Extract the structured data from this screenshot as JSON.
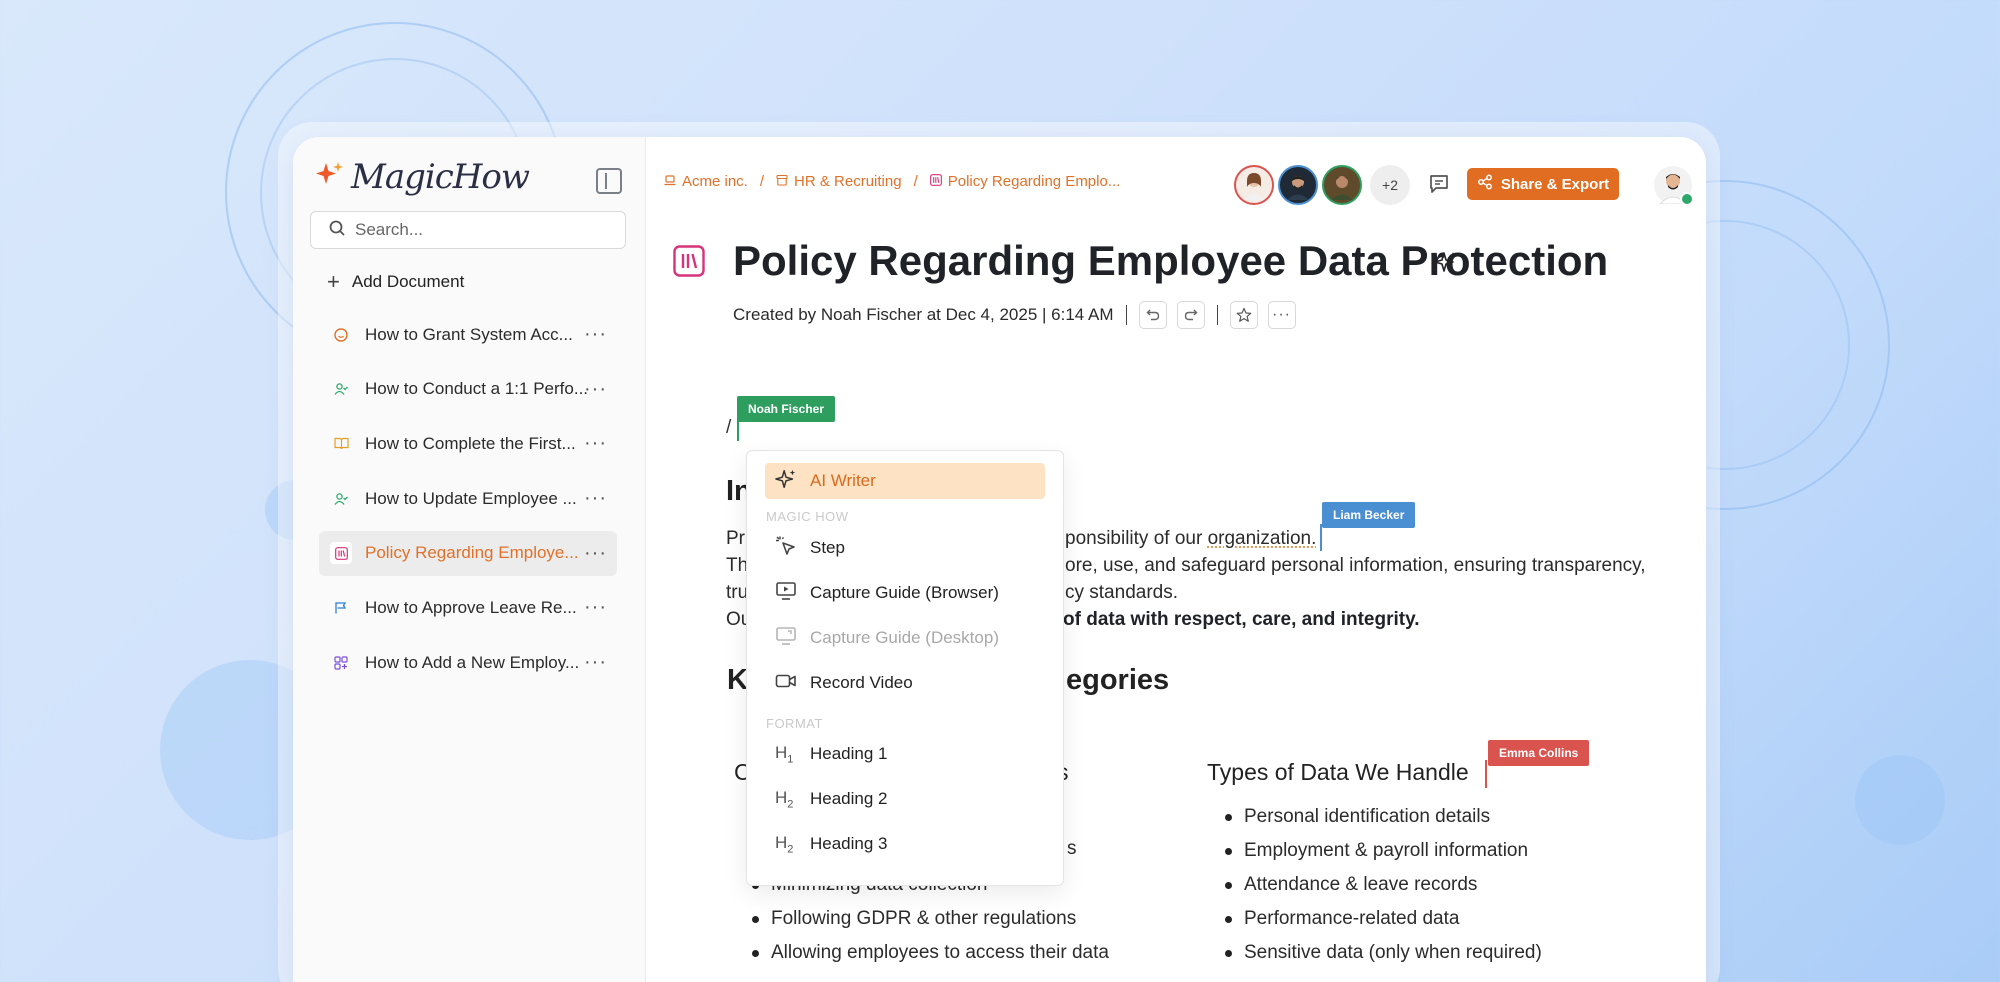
{
  "app": {
    "name": "MagicHow"
  },
  "sidebar": {
    "search_placeholder": "Search...",
    "add_document": "Add Document",
    "items": [
      {
        "label": "How to Grant System Acc...",
        "icon": "smile-icon",
        "color": "#e0712a"
      },
      {
        "label": "How to Conduct a 1:1 Perfo...",
        "icon": "user-check-icon",
        "color": "#2ea86a"
      },
      {
        "label": "How to Complete the First...",
        "icon": "book-open-icon",
        "color": "#e0a02a"
      },
      {
        "label": "How to Update Employee ...",
        "icon": "user-check-icon",
        "color": "#2ea86a"
      },
      {
        "label": "Policy Regarding Employe...",
        "icon": "library-icon",
        "color": "#d6337a",
        "active": true
      },
      {
        "label": "How to Approve Leave Re...",
        "icon": "message-flag-icon",
        "color": "#2f7fd6"
      },
      {
        "label": "How to Add a New Employ...",
        "icon": "grid-icon",
        "color": "#7b4fd6"
      }
    ]
  },
  "breadcrumb": [
    {
      "label": "Acme inc.",
      "icon": "laptop-icon"
    },
    {
      "label": "HR & Recruiting",
      "icon": "folder-icon"
    },
    {
      "label": "Policy Regarding Emplo...",
      "icon": "library-icon"
    }
  ],
  "header": {
    "avatar_more": "+2",
    "share_label": "Share & Export",
    "accent": "#e06d21"
  },
  "doc": {
    "title": "Policy Regarding Employee Data Protection",
    "meta": "Created by Noah Fischer at Dec 4, 2025 | 6:14 AM",
    "slash": "/",
    "intro_heading_visible": "In",
    "para1_start": "Pr",
    "para1_end": "ponsibility of our",
    "para1_link": "organization.",
    "para2_start": "Th",
    "para2_end": "ore, use, and safeguard personal information, ensuring transparency,",
    "para3_start": "tru",
    "para3_end": "cy standards.",
    "para4_start": "Ou",
    "para4_end": "of data with respect, care, and integrity.",
    "key_heading_start": "K",
    "key_heading_end": "egories",
    "col1_heading_start": "C",
    "col1_heading_end": "s",
    "col1_items": [
      "s",
      "Minimizing data collection",
      "Following GDPR & other regulations",
      "Allowing employees to access their data"
    ],
    "col2_heading": "Types of Data We Handle",
    "col2_items": [
      "Personal identification details",
      "Employment & payroll information",
      "Attendance & leave records",
      "Performance-related data",
      "Sensitive data (only when required)"
    ]
  },
  "collaborators": [
    {
      "name": "Noah Fischer",
      "color": "#2e9e5e"
    },
    {
      "name": "Liam Becker",
      "color": "#4a8fd1"
    },
    {
      "name": "Emma Collins",
      "color": "#d9534f"
    }
  ],
  "slash_menu": {
    "ai_writer": "AI Writer",
    "section_magic": "MAGIC HOW",
    "step": "Step",
    "capture_browser": "Capture Guide (Browser)",
    "capture_desktop": "Capture Guide (Desktop)",
    "record_video": "Record Video",
    "section_format": "FORMAT",
    "heading1": "Heading 1",
    "heading2": "Heading 2",
    "heading3": "Heading 3"
  }
}
